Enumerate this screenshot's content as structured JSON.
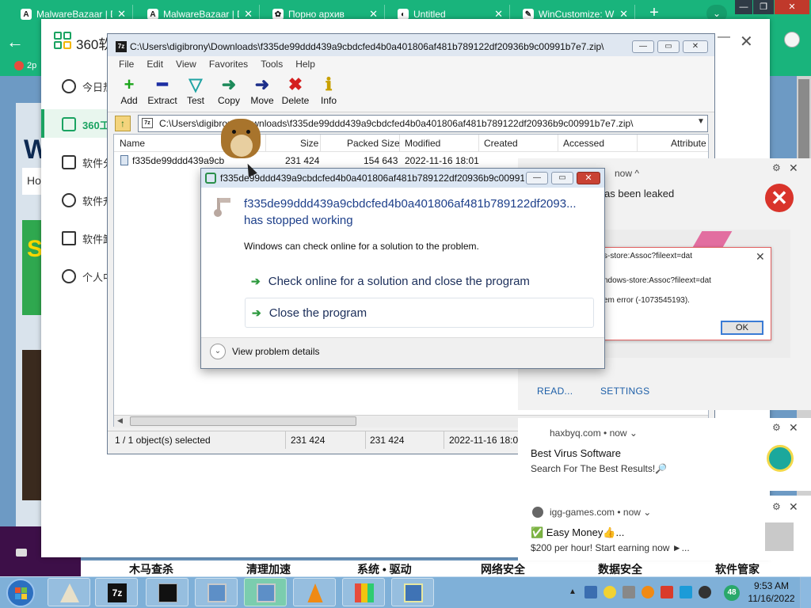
{
  "browser": {
    "tabs": [
      {
        "label": "MalwareBazaar | D",
        "icon": "A"
      },
      {
        "label": "MalwareBazaar | D",
        "icon": "A"
      },
      {
        "label": "Порно архив",
        "icon": "✿"
      },
      {
        "label": "Untitled",
        "icon": "◐"
      },
      {
        "label": "WinCustomize: W",
        "icon": "✎"
      }
    ],
    "new_tab": "+",
    "tab_menu": "⌄",
    "bookmark": "2p",
    "accent": "#19b47c"
  },
  "web": {
    "big_letter": "W",
    "input_text": "Ho",
    "green_ad_text": "S",
    "bottom_nav": [
      "木马查杀",
      "清理加速",
      "系统 • 驱动",
      "网络安全",
      "数据安全",
      "软件管家"
    ]
  },
  "app360": {
    "title": "360软",
    "sidebar": [
      "今日热",
      "360工",
      "软件分",
      "软件升",
      "软件卸",
      "个人中"
    ]
  },
  "zip": {
    "title": "C:\\Users\\digibrony\\Downloads\\f335de99ddd439a9cbdcfed4b0a401806af481b789122df20936b9c00991b7e7.zip\\",
    "app_icon": "7z",
    "menu": [
      "File",
      "Edit",
      "View",
      "Favorites",
      "Tools",
      "Help"
    ],
    "toolbar": [
      {
        "label": "Add",
        "icon": "+",
        "color": "#1aa51a"
      },
      {
        "label": "Extract",
        "icon": "━",
        "color": "#1d2fa3"
      },
      {
        "label": "Test",
        "icon": "▽",
        "color": "#1fa3a3"
      },
      {
        "label": "Copy",
        "icon": "➜",
        "color": "#1d8a5a"
      },
      {
        "label": "Move",
        "icon": "➜",
        "color": "#1d2f8a"
      },
      {
        "label": "Delete",
        "icon": "✖",
        "color": "#d42020"
      },
      {
        "label": "Info",
        "icon": "ℹ",
        "color": "#c8a000"
      }
    ],
    "address": "C:\\Users\\digibrony\\Downloads\\f335de99ddd439a9cbdcfed4b0a401806af481b789122df20936b9c00991b7e7.zip\\",
    "columns": [
      "Name",
      "Size",
      "Packed Size",
      "Modified",
      "Created",
      "Accessed",
      "Attribute"
    ],
    "rows": [
      {
        "name": "f335de99ddd439a9cb",
        "size": "231 424",
        "packed": "154 643",
        "modified": "2022-11-16 18:01"
      }
    ],
    "status": {
      "selected": "1 / 1 object(s) selected",
      "size": "231 424",
      "packed": "231 424",
      "modified": "2022-11-16 18:01"
    }
  },
  "crash": {
    "title": "f335de99ddd439a9cbdcfed4b0a401806af481b789122df20936b9c00991b...",
    "app_name": "f335de99ddd439a9cbdcfed4b0a401806af481b789122df2093...",
    "stopped": "has stopped working",
    "message": "Windows can check online for a solution to the problem.",
    "option1": "Check online for a solution and close the program",
    "option2": "Close the program",
    "details": "View problem details"
  },
  "notifications": {
    "top": {
      "time": "now",
      "leaked": "as been leaked",
      "err_line1": "s-store:Assoc?fileext=dat",
      "err_line2": "ndows-store:Assoc?fileext=dat",
      "err_line3": "em error (-1073545193).",
      "ok": "OK",
      "read": "READ...",
      "settings": "SETTINGS"
    },
    "n2": {
      "source": "haxbyq.com",
      "time": "now",
      "title": "Best Virus Software",
      "sub": "Search For The Best Results!🔎"
    },
    "n3": {
      "source": "igg-games.com",
      "time": "now",
      "title": "✅ Easy Money👍...",
      "sub": "$200 per hour! Start earning now ►..."
    }
  },
  "taskbar": {
    "tray_badge": "48",
    "time": "9:53 AM",
    "date": "11/16/2022"
  }
}
